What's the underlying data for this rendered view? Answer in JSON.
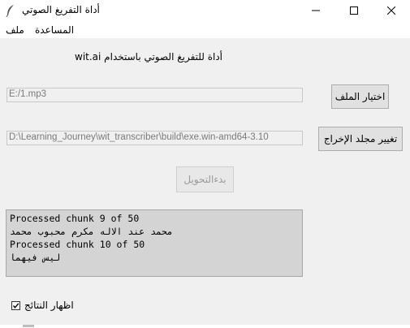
{
  "window": {
    "title": "أداة التفريغ الصوتي",
    "controls": [
      "minimize-icon",
      "maximize-icon",
      "close-icon"
    ]
  },
  "menu": {
    "help": "المساعدة",
    "file": "ملف"
  },
  "header": {
    "label": "أداة للتفريغ الصوتي باستخدام wit.ai"
  },
  "file_input": {
    "value": "E:/1.mp3",
    "button": "اختيار الملف"
  },
  "output_dir": {
    "value": "D:\\Learning_Journey\\wit_transcriber\\build\\exe.win-amd64-3.10",
    "button": "تغيير مجلد الإخراج"
  },
  "start_button": {
    "label": "بدءالتحويل",
    "enabled": false
  },
  "log": {
    "lines": [
      "Processed chunk 9 of 50",
      "محمد عند الاله مكرم محبوب محمد",
      "Processed chunk 10 of 50",
      "ليس فيهما"
    ]
  },
  "show_results": {
    "label": "اظهار النتائج",
    "checked": true
  }
}
